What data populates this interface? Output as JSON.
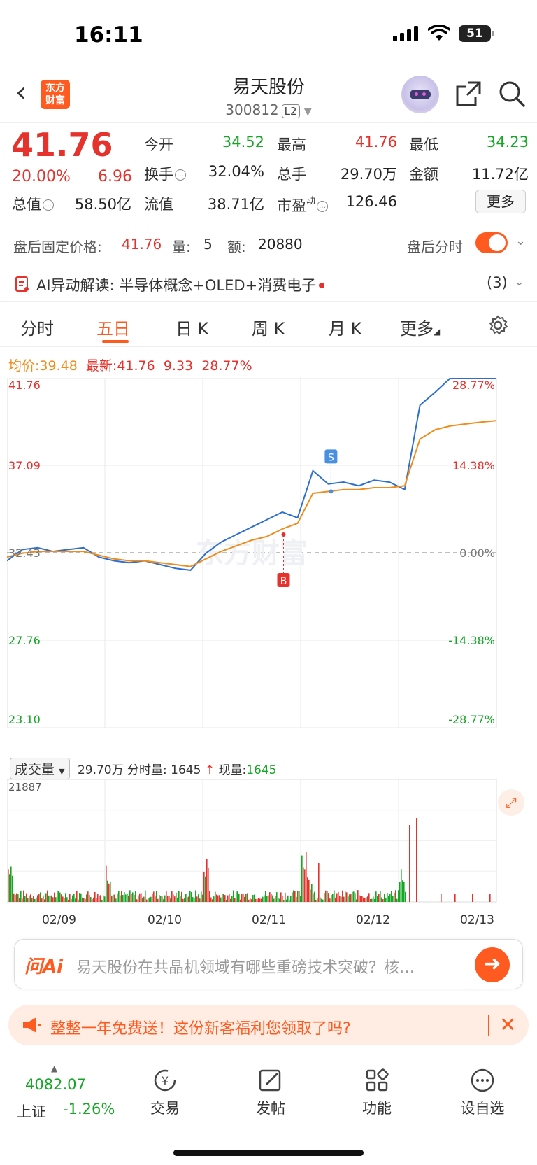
{
  "status": {
    "time": "16:11",
    "battery": "51"
  },
  "header": {
    "back_icon": "chevron-left-icon",
    "logo_text_1": "东方",
    "logo_text_2": "财富",
    "title": "易天股份",
    "code": "300812",
    "level": "L2"
  },
  "quote": {
    "price": "41.76",
    "pct": "20.00%",
    "change": "6.96",
    "open_label": "今开",
    "open": "34.52",
    "high_label": "最高",
    "high": "41.76",
    "low_label": "最低",
    "low": "34.23",
    "turnover_label": "换手",
    "turnover": "32.04%",
    "volume_label": "总手",
    "volume": "29.70万",
    "amount_label": "金额",
    "amount": "11.72亿",
    "mktcap_label": "总值",
    "mktcap": "58.50亿",
    "float_label": "流值",
    "float": "38.71亿",
    "pe_label": "市盈",
    "pe_sup": "动",
    "pe": "126.46",
    "more": "更多"
  },
  "after_hours": {
    "label": "盘后固定价格:",
    "price": "41.76",
    "qty_label": "量:",
    "qty": "5",
    "amt_label": "额:",
    "amt": "20880",
    "intraday_label": "盘后分时"
  },
  "ai_row": {
    "label": "AI异动解读:",
    "text": "半导体概念+OLED+消费电子",
    "count": "(3)"
  },
  "tabs": [
    "分时",
    "五日",
    "日 K",
    "周 K",
    "月 K",
    "更多"
  ],
  "active_tab": 1,
  "info_line": {
    "avg_label": "均价:",
    "avg": "39.48",
    "last_label": "最新:",
    "last": "41.76",
    "chg": "9.33",
    "pct": "28.77%"
  },
  "chart_data": {
    "type": "line",
    "title": "",
    "x_dates": [
      "02/09",
      "02/10",
      "02/11",
      "02/12",
      "02/13"
    ],
    "y_ticks_left": [
      "41.76",
      "37.09",
      "32.43",
      "27.76",
      "23.10"
    ],
    "y_ticks_right": [
      "28.77%",
      "14.38%",
      "0.00%",
      "-14.38%",
      "-28.77%"
    ],
    "ylim": [
      23.1,
      41.76
    ],
    "prev_close": 32.43,
    "series": [
      {
        "name": "",
        "color": "#2d6fd0",
        "values": [
          32.0,
          32.6,
          32.7,
          32.5,
          32.6,
          32.7,
          32.2,
          32.0,
          31.9,
          32.0,
          31.8,
          31.6,
          31.5,
          32.4,
          33.0,
          33.4,
          33.8,
          34.2,
          34.6,
          34.3,
          36.8,
          36.1,
          36.2,
          36.0,
          36.3,
          36.2,
          35.8,
          40.3,
          41.0,
          41.76,
          41.76,
          41.76,
          41.76
        ]
      },
      {
        "name": "",
        "color": "#f08c1a",
        "values": [
          32.2,
          32.4,
          32.5,
          32.5,
          32.5,
          32.5,
          32.3,
          32.1,
          32.0,
          32.0,
          31.9,
          31.8,
          31.7,
          32.1,
          32.5,
          32.8,
          33.1,
          33.3,
          33.7,
          34.0,
          35.6,
          35.7,
          35.8,
          35.8,
          35.9,
          35.9,
          36.0,
          38.5,
          39.0,
          39.2,
          39.3,
          39.4,
          39.48
        ]
      }
    ],
    "markers": [
      {
        "label": "S",
        "color": "#4a90e2"
      },
      {
        "label": "B",
        "color": "#e5322d"
      }
    ],
    "watermark": "东方财富"
  },
  "volume": {
    "select_label": "成交量",
    "total": "29.70万",
    "tick_label": "分时量: 1645",
    "now_label": "现量:",
    "now": "1645",
    "max": "21887",
    "expand_icon": "expand-icon"
  },
  "ask": {
    "logo": "问Ai",
    "placeholder": "易天股份在共晶机领域有哪些重磅技术突破？核…",
    "go_icon": "arrow-right-icon"
  },
  "promo": {
    "text": "整整一年免费送！这份新客福利您领取了吗?",
    "icon": "megaphone-icon"
  },
  "bottom": {
    "index_value": "4082.07",
    "index_name": "上证",
    "index_pct": "-1.26%",
    "nav": [
      "交易",
      "发帖",
      "功能",
      "设自选"
    ]
  }
}
